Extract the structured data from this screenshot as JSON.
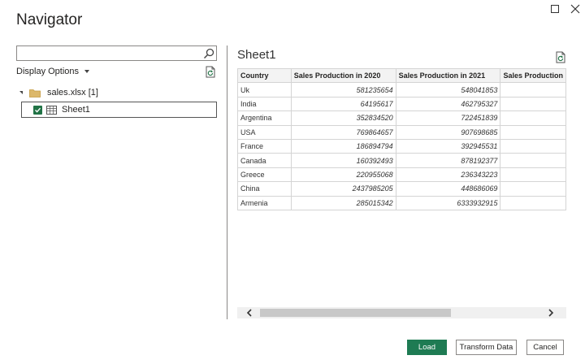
{
  "window": {
    "title": "Navigator"
  },
  "icons": {
    "maximize": "maximize-icon",
    "close": "close-icon",
    "search": "search-icon",
    "refresh": "refresh-icon",
    "folder": "folder-icon",
    "sheet": "sheet-icon",
    "check": "checkbox-checked-icon"
  },
  "colors": {
    "accent": "#1e7b53",
    "checkbox": "#217346",
    "folder": "#dcb86a"
  },
  "left_pane": {
    "search_value": "",
    "search_placeholder": "",
    "display_options_label": "Display Options",
    "tree": {
      "file_label": "sales.xlsx [1]",
      "sheet_label": "Sheet1",
      "sheet_checked": true
    }
  },
  "preview": {
    "title": "Sheet1",
    "columns": [
      "Country",
      "Sales Production in 2020",
      "Sales Production in 2021",
      "Sales Production"
    ],
    "rows": [
      [
        "Uk",
        "581235654",
        "548041853"
      ],
      [
        "India",
        "64195617",
        "462795327"
      ],
      [
        "Argentina",
        "352834520",
        "722451839"
      ],
      [
        "USA",
        "769864657",
        "907698685"
      ],
      [
        "France",
        "186894794",
        "392945531"
      ],
      [
        "Canada",
        "160392493",
        "878192377"
      ],
      [
        "Greece",
        "220955068",
        "236343223"
      ],
      [
        "China",
        "2437985205",
        "448686069"
      ],
      [
        "Armenia",
        "285015342",
        "6333932915"
      ]
    ]
  },
  "footer": {
    "load_label": "Load",
    "transform_label": "Transform Data",
    "cancel_label": "Cancel"
  }
}
